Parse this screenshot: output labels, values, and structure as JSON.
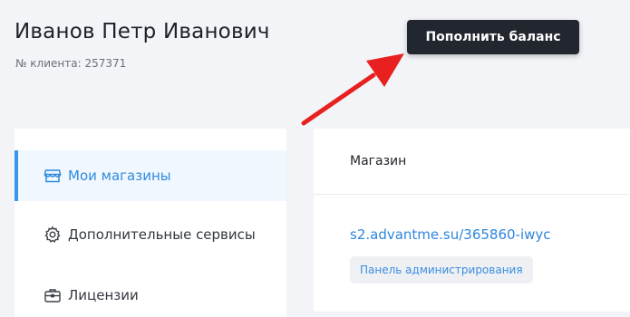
{
  "client": {
    "name": "Иванов Петр Иванович",
    "id_label": "№ клиента: 257371"
  },
  "header": {
    "topup_button": "Пополнить баланс"
  },
  "sidebar": {
    "items": [
      {
        "label": "Мои магазины",
        "icon": "store-icon",
        "active": true
      },
      {
        "label": "Дополнительные сервисы",
        "icon": "gear-icon",
        "active": false
      },
      {
        "label": "Лицензии",
        "icon": "briefcase-icon",
        "active": false
      }
    ]
  },
  "shops_table": {
    "column_header": "Магазин",
    "rows": [
      {
        "link": "s2.advantme.su/365860-iwyc",
        "admin_button": "Панель администрирования"
      }
    ]
  },
  "colors": {
    "accent": "#2e8ae0",
    "annotation_arrow": "#e8201f",
    "dark_button": "#22262e"
  }
}
